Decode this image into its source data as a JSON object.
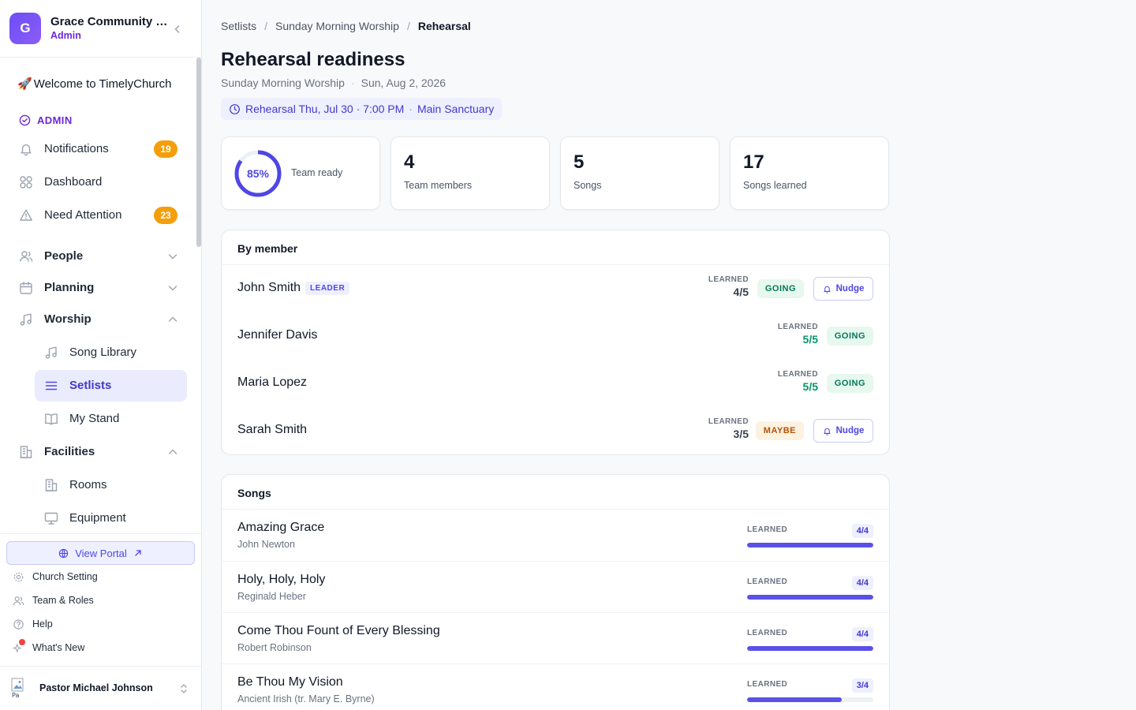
{
  "org": {
    "initial": "G",
    "name": "Grace Community Church",
    "role": "Admin"
  },
  "sidebar": {
    "welcome": "Welcome to TimelyChurch",
    "section_admin": "ADMIN",
    "notifications": {
      "label": "Notifications",
      "count": "19"
    },
    "dashboard": "Dashboard",
    "need_attention": {
      "label": "Need Attention",
      "count": "23"
    },
    "people": "People",
    "planning": "Planning",
    "worship": "Worship",
    "song_library": "Song Library",
    "setlists": "Setlists",
    "my_stand": "My Stand",
    "facilities": "Facilities",
    "rooms": "Rooms",
    "equipment": "Equipment"
  },
  "footer": {
    "view_portal": "View Portal",
    "church_setting": "Church Setting",
    "team_roles": "Team & Roles",
    "help": "Help",
    "whats_new": "What's New",
    "user_name": "Pastor Michael Johnson"
  },
  "breadcrumb": {
    "root": "Setlists",
    "parent": "Sunday Morning Worship",
    "current": "Rehearsal"
  },
  "page": {
    "title": "Rehearsal readiness",
    "service": "Sunday Morning Worship",
    "service_date": "Sun, Aug 2, 2026",
    "rehearsal_time": "Rehearsal Thu, Jul 30 · 7:00 PM",
    "rehearsal_location": "Main Sanctuary"
  },
  "stats": {
    "ready_percent": 85,
    "ready_label": "85%",
    "ready_caption": "Team ready",
    "team_members": "4",
    "team_members_caption": "Team members",
    "songs": "5",
    "songs_caption": "Songs",
    "songs_learned": "17",
    "songs_learned_caption": "Songs learned"
  },
  "members_card": {
    "title": "By member",
    "learned_label": "LEARNED",
    "nudge_label": "Nudge",
    "leader_label": "LEADER",
    "rows": [
      {
        "name": "John Smith",
        "learned": "4/5",
        "status": "GOING"
      },
      {
        "name": "Jennifer Davis",
        "learned": "5/5",
        "status": "GOING"
      },
      {
        "name": "Maria Lopez",
        "learned": "5/5",
        "status": "GOING"
      },
      {
        "name": "Sarah Smith",
        "learned": "3/5",
        "status": "MAYBE"
      }
    ]
  },
  "songs_card": {
    "title": "Songs",
    "learned_label": "LEARNED",
    "rows": [
      {
        "title": "Amazing Grace",
        "author": "John Newton",
        "count": "4/4",
        "progress": 1.0
      },
      {
        "title": "Holy, Holy, Holy",
        "author": "Reginald Heber",
        "count": "4/4",
        "progress": 1.0
      },
      {
        "title": "Come Thou Fount of Every Blessing",
        "author": "Robert Robinson",
        "count": "4/4",
        "progress": 1.0
      },
      {
        "title": "Be Thou My Vision",
        "author": "Ancient Irish (tr. Mary E. Byrne)",
        "count": "3/4",
        "progress": 0.75
      }
    ]
  },
  "colors": {
    "accent": "#4f46e5",
    "warning_badge": "#f59e0b",
    "going": "#047857",
    "maybe": "#b45309"
  }
}
